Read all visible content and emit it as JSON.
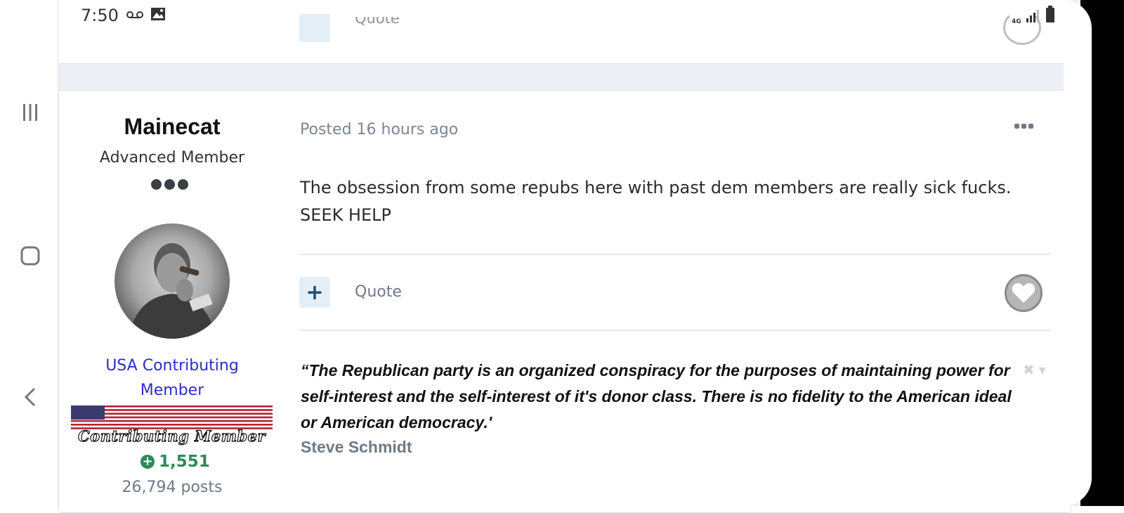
{
  "status_bar": {
    "time": "7:50",
    "network": "4G"
  },
  "previous_post": {
    "quote_label": "Quote"
  },
  "post": {
    "author": {
      "name": "Mainecat",
      "rank": "Advanced Member",
      "group": "USA Contributing Member",
      "badge_text": "Contributing Member",
      "reputation": "1,551",
      "post_count": "26,794 posts"
    },
    "meta": "Posted 16 hours ago",
    "body": [
      "The obsession from some repubs here with past dem members are really sick fucks.",
      "SEEK HELP"
    ],
    "actions": {
      "plus_label": "+",
      "quote_label": "Quote"
    },
    "signature": {
      "quote": "“The Republican party is an organized conspiracy for the purposes of maintaining power for self-interest and the self-interest of it's donor class. There is no fidelity to the American ideal or American democracy.'",
      "author": "Steve Schmidt"
    }
  },
  "colors": {
    "group_link": "#2c2cc8",
    "reputation": "#2c8a5a",
    "accent_button_bg": "#e4eef7"
  },
  "icons": [
    "voicemail-icon",
    "gallery-icon",
    "signal-icon",
    "battery-icon",
    "recent-apps-icon",
    "home-icon",
    "back-icon",
    "more-icon",
    "heart-icon",
    "reputation-plus-icon"
  ]
}
